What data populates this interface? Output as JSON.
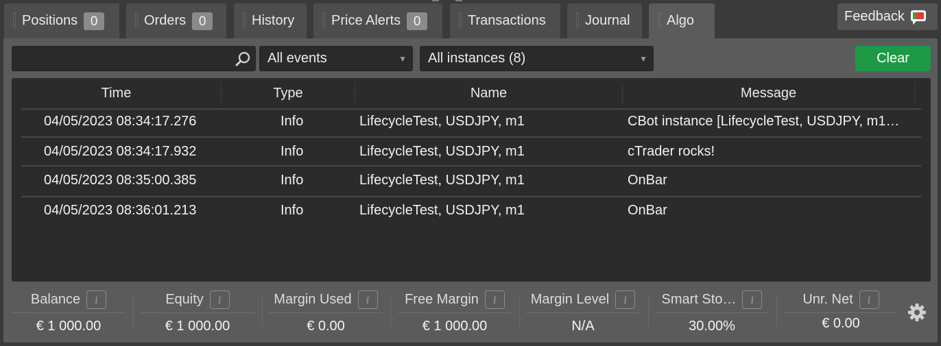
{
  "tabs": [
    {
      "label": "Positions",
      "badge": "0"
    },
    {
      "label": "Orders",
      "badge": "0"
    },
    {
      "label": "History"
    },
    {
      "label": "Price Alerts",
      "badge": "0"
    },
    {
      "label": "Transactions"
    },
    {
      "label": "Journal"
    },
    {
      "label": "Algo"
    }
  ],
  "active_tab": "Algo",
  "feedback": {
    "label": "Feedback",
    "icon": "feedback-flag-icon"
  },
  "filters": {
    "search": {
      "value": "",
      "placeholder": "",
      "icon": "search-icon"
    },
    "events": {
      "selected": "All events"
    },
    "instances": {
      "selected": "All instances (8)"
    },
    "clear_label": "Clear"
  },
  "log_table": {
    "headers": {
      "time": "Time",
      "type": "Type",
      "name": "Name",
      "message": "Message"
    },
    "rows": [
      {
        "time": "04/05/2023 08:34:17.276",
        "type": "Info",
        "name": "LifecycleTest, USDJPY, m1",
        "message": "CBot instance [LifecycleTest, USDJPY, m1…"
      },
      {
        "time": "04/05/2023 08:34:17.932",
        "type": "Info",
        "name": "LifecycleTest, USDJPY, m1",
        "message": "cTrader rocks!"
      },
      {
        "time": "04/05/2023 08:35:00.385",
        "type": "Info",
        "name": "LifecycleTest, USDJPY, m1",
        "message": "OnBar"
      },
      {
        "time": "04/05/2023 08:36:01.213",
        "type": "Info",
        "name": "LifecycleTest, USDJPY, m1",
        "message": "OnBar"
      }
    ]
  },
  "account": {
    "balance": {
      "label": "Balance",
      "value": "€ 1 000.00"
    },
    "equity": {
      "label": "Equity",
      "value": "€ 1 000.00"
    },
    "margin_used": {
      "label": "Margin Used",
      "value": "€ 0.00"
    },
    "free_margin": {
      "label": "Free Margin",
      "value": "€ 1 000.00"
    },
    "margin_level": {
      "label": "Margin Level",
      "value": "N/A"
    },
    "smart_stop": {
      "label": "Smart Sto…",
      "value": "30.00%"
    },
    "unr_net": {
      "label": "Unr. Net",
      "value": "€ 0.00"
    },
    "info_glyph": "i",
    "settings_icon": "gear-icon"
  },
  "colors": {
    "accent_green": "#1c9a46",
    "panel": "#5b5b5b",
    "grid_bg": "#2b2b2b"
  }
}
